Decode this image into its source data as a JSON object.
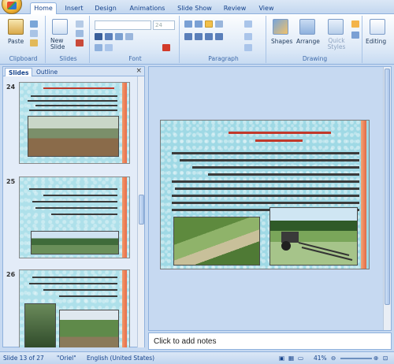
{
  "ribbon": {
    "tabs": [
      "Home",
      "Insert",
      "Design",
      "Animations",
      "Slide Show",
      "Review",
      "View"
    ],
    "active_tab": "Home",
    "groups": {
      "clipboard": {
        "label": "Clipboard",
        "paste": "Paste"
      },
      "slides": {
        "label": "Slides",
        "new_slide": "New Slide"
      },
      "font": {
        "label": "Font",
        "size_value": "24"
      },
      "paragraph": {
        "label": "Paragraph"
      },
      "drawing": {
        "label": "Drawing",
        "shapes": "Shapes",
        "arrange": "Arrange",
        "quick_styles": "Quick Styles"
      },
      "editing": {
        "label": "Editing"
      }
    }
  },
  "left_panel": {
    "tabs": [
      "Slides",
      "Outline"
    ],
    "active_tab": "Slides",
    "close": "×",
    "slides": [
      {
        "number": "24"
      },
      {
        "number": "25"
      },
      {
        "number": "26"
      }
    ]
  },
  "notes": {
    "placeholder": "Click to add notes"
  },
  "status_bar": {
    "slide_info": "Slide 13 of 27",
    "theme": "\"Oriel\"",
    "language": "English (United States)",
    "zoom": "41%"
  },
  "colors": {
    "accent": "#15428b",
    "ribbon_bg": "#dde9f7",
    "slide_bg": "#9fd9e5",
    "slide_bar": "#e86b4a"
  }
}
